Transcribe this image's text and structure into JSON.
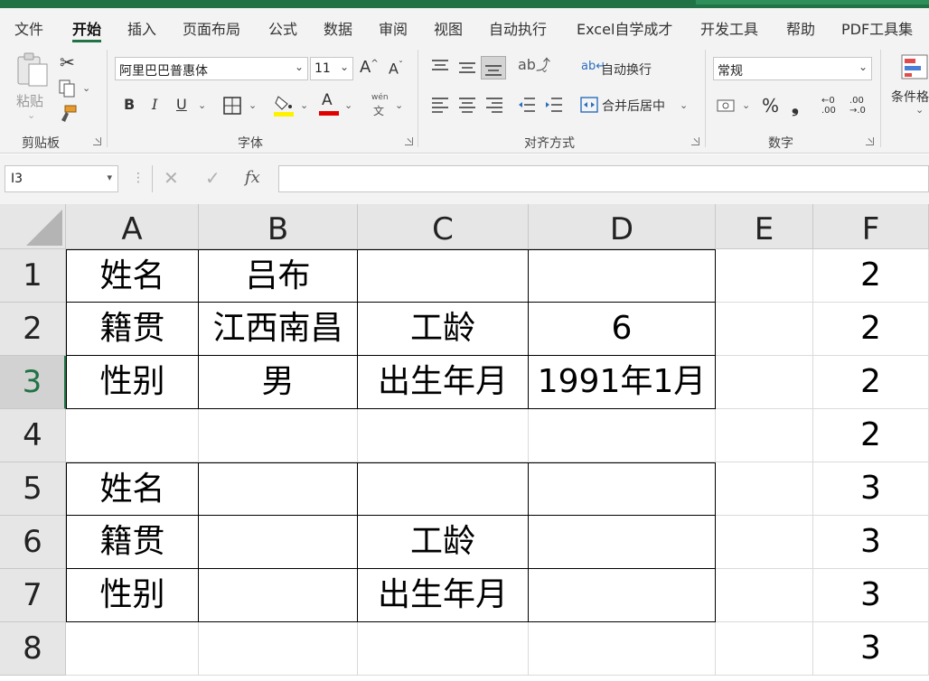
{
  "tabs": [
    "文件",
    "开始",
    "插入",
    "页面布局",
    "公式",
    "数据",
    "审阅",
    "视图",
    "自动执行",
    "Excel自学成才",
    "开发工具",
    "帮助",
    "PDF工具集"
  ],
  "active_tab": "开始",
  "clipboard": {
    "paste_label": "粘贴",
    "group_label": "剪贴板"
  },
  "font": {
    "name": "阿里巴巴普惠体",
    "size": "11",
    "bold": "B",
    "italic": "I",
    "underline": "U",
    "font_color_glyph": "A",
    "phonetic_top": "wén",
    "phonetic_bottom": "文",
    "group_label": "字体",
    "highlight_color": "#FFF200",
    "font_color": "#E00000"
  },
  "alignment": {
    "wrap_text": "自动换行",
    "merge_center": "合并后居中",
    "group_label": "对齐方式"
  },
  "number": {
    "format": "常规",
    "percent": "%",
    "comma": "❟",
    "group_label": "数字"
  },
  "styles": {
    "conditional_format": "条件格"
  },
  "formula_bar": {
    "name_box": "I3",
    "fx": "fx",
    "formula": ""
  },
  "columns": [
    "A",
    "B",
    "C",
    "D",
    "E",
    "F"
  ],
  "rows": [
    {
      "num": "1",
      "cells": [
        "姓名",
        "吕布",
        "",
        "",
        "",
        "2"
      ]
    },
    {
      "num": "2",
      "cells": [
        "籍贯",
        "江西南昌",
        "工龄",
        "6",
        "",
        "2"
      ]
    },
    {
      "num": "3",
      "cells": [
        "性别",
        "男",
        "出生年月",
        "1991年1月",
        "",
        "2"
      ]
    },
    {
      "num": "4",
      "cells": [
        "",
        "",
        "",
        "",
        "",
        "2"
      ]
    },
    {
      "num": "5",
      "cells": [
        "姓名",
        "",
        "",
        "",
        "",
        "3"
      ]
    },
    {
      "num": "6",
      "cells": [
        "籍贯",
        "",
        "工龄",
        "",
        "",
        "3"
      ]
    },
    {
      "num": "7",
      "cells": [
        "性别",
        "",
        "出生年月",
        "",
        "",
        "3"
      ]
    },
    {
      "num": "8",
      "cells": [
        "",
        "",
        "",
        "",
        "",
        "3"
      ]
    }
  ],
  "selected_row": "3",
  "accent": "#217346"
}
